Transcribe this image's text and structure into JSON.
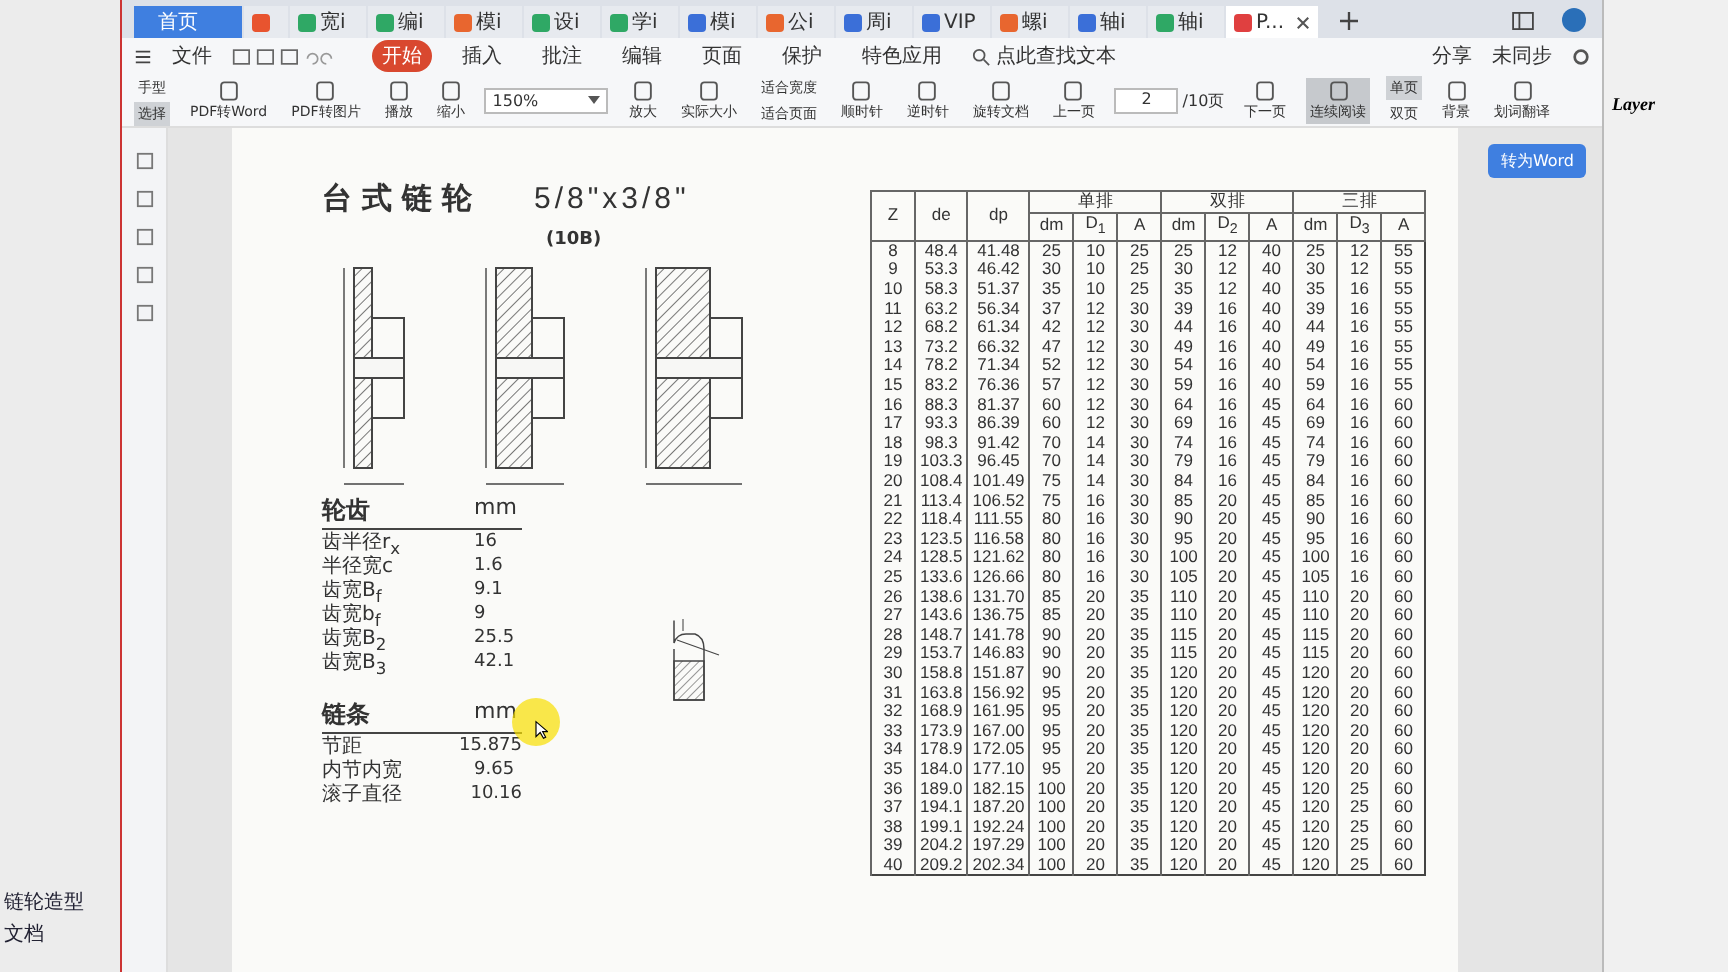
{
  "tabs": [
    {
      "label": "首页",
      "kind": "home",
      "selected": false
    },
    {
      "kind": "app",
      "color": "#e8542f",
      "selected": false
    },
    {
      "label": "宽i",
      "kind": "doc",
      "color": "#2fa865",
      "selected": false
    },
    {
      "label": "编i",
      "kind": "doc",
      "color": "#2fa865",
      "selected": false
    },
    {
      "label": "模i",
      "kind": "doc",
      "color": "#e8662f",
      "selected": false
    },
    {
      "label": "设i",
      "kind": "doc",
      "color": "#2fa865",
      "selected": false
    },
    {
      "label": "学i",
      "kind": "doc",
      "color": "#2fa865",
      "selected": false
    },
    {
      "label": "模i",
      "kind": "doc",
      "color": "#3b6fd8",
      "selected": false
    },
    {
      "label": "公i",
      "kind": "doc",
      "color": "#e8662f",
      "selected": false
    },
    {
      "label": "周i",
      "kind": "doc",
      "color": "#3b6fd8",
      "selected": false
    },
    {
      "label": "VIP",
      "kind": "doc",
      "color": "#3b6fd8",
      "selected": false
    },
    {
      "label": "螺i",
      "kind": "doc",
      "color": "#e8662f",
      "selected": false
    },
    {
      "label": "轴i",
      "kind": "doc",
      "color": "#3b6fd8",
      "selected": false
    },
    {
      "label": "轴i",
      "kind": "doc",
      "color": "#2fa865",
      "selected": false
    },
    {
      "label": "P...",
      "kind": "doc",
      "color": "#e04040",
      "selected": true
    }
  ],
  "menu": {
    "file": "文件",
    "items": [
      {
        "label": "开始",
        "selected": true
      },
      {
        "label": "插入",
        "selected": false
      },
      {
        "label": "批注",
        "selected": false
      },
      {
        "label": "编辑",
        "selected": false
      },
      {
        "label": "页面",
        "selected": false
      },
      {
        "label": "保护",
        "selected": false
      },
      {
        "label": "特色应用",
        "selected": false
      }
    ],
    "search": "点此查找文本",
    "share": "分享",
    "sync": "未同步"
  },
  "toolbar": [
    {
      "kind": "stack",
      "items": [
        {
          "label": "手型",
          "selected": false
        },
        {
          "label": "选择",
          "selected": true
        }
      ]
    },
    {
      "kind": "big",
      "label": "PDF转Word",
      "selected": false
    },
    {
      "kind": "big",
      "label": "PDF转图片",
      "selected": false
    },
    {
      "kind": "big",
      "label": "播放",
      "selected": false
    },
    {
      "kind": "big",
      "label": "缩小",
      "selected": false
    },
    {
      "kind": "zoom",
      "value": "150%"
    },
    {
      "kind": "big",
      "label": "放大",
      "selected": false
    },
    {
      "kind": "big",
      "label": "实际大小",
      "selected": false
    },
    {
      "kind": "stack",
      "items": [
        {
          "label": "适合宽度",
          "selected": false
        },
        {
          "label": "适合页面",
          "selected": false
        }
      ]
    },
    {
      "kind": "big",
      "label": "顺时针",
      "selected": false
    },
    {
      "kind": "big",
      "label": "逆时针",
      "selected": false
    },
    {
      "kind": "big",
      "label": "旋转文档",
      "selected": false
    },
    {
      "kind": "big",
      "label": "上一页",
      "selected": false
    },
    {
      "kind": "page",
      "value": "2",
      "total": "/10页"
    },
    {
      "kind": "big",
      "label": "下一页",
      "selected": false
    },
    {
      "kind": "big",
      "label": "连续阅读",
      "selected": true
    },
    {
      "kind": "stack",
      "items": [
        {
          "label": "单页",
          "selected": true
        },
        {
          "label": "双页",
          "selected": false
        }
      ]
    },
    {
      "kind": "big",
      "label": "背景",
      "selected": false
    },
    {
      "kind": "big",
      "label": "划词翻译",
      "selected": false
    }
  ],
  "to_word": "转为Word",
  "background_app": {
    "layer": "Layer",
    "file": "链轮造型",
    "doc": "文档"
  },
  "doc": {
    "title": "台式链轮",
    "size": "5/8\"x3/8\"",
    "code": "(10B)",
    "tooth": {
      "heading": "轮齿",
      "unit": "mm",
      "rows": [
        [
          "齿半径r$_{x}$",
          "16"
        ],
        [
          "半径宽c",
          "1.6"
        ],
        [
          "齿宽B$_{f}$",
          "9.1"
        ],
        [
          "齿宽b$_{f}$",
          "9"
        ],
        [
          "齿宽B$_{2}$",
          "25.5"
        ],
        [
          "齿宽B$_{3}$",
          "42.1"
        ]
      ]
    },
    "chain": {
      "heading": "链条",
      "unit": "mm",
      "rows": [
        [
          "节距",
          "15.875"
        ],
        [
          "内节内宽",
          "9.65"
        ],
        [
          "滚子直径",
          "10.16"
        ]
      ]
    },
    "table": {
      "top": [
        {
          "label": "Z",
          "kind": "single"
        },
        {
          "label": "de",
          "kind": "single"
        },
        {
          "label": "dp",
          "kind": "single"
        },
        {
          "label": "单排",
          "kind": "group"
        },
        {
          "label": "双排",
          "kind": "group"
        },
        {
          "label": "三排",
          "kind": "group"
        }
      ],
      "sub": [
        "dm",
        "D$_{1}$",
        "A",
        "dm",
        "D$_{2}$",
        "A",
        "dm",
        "D$_{3}$",
        "A"
      ],
      "rows": [
        [
          "8",
          "48.4",
          "41.48",
          "25",
          "10",
          "25",
          "25",
          "12",
          "40",
          "25",
          "12",
          "55"
        ],
        [
          "9",
          "53.3",
          "46.42",
          "30",
          "10",
          "25",
          "30",
          "12",
          "40",
          "30",
          "12",
          "55"
        ],
        [
          "10",
          "58.3",
          "51.37",
          "35",
          "10",
          "25",
          "35",
          "12",
          "40",
          "35",
          "16",
          "55"
        ],
        [
          "11",
          "63.2",
          "56.34",
          "37",
          "12",
          "30",
          "39",
          "16",
          "40",
          "39",
          "16",
          "55"
        ],
        [
          "12",
          "68.2",
          "61.34",
          "42",
          "12",
          "30",
          "44",
          "16",
          "40",
          "44",
          "16",
          "55"
        ],
        [
          "13",
          "73.2",
          "66.32",
          "47",
          "12",
          "30",
          "49",
          "16",
          "40",
          "49",
          "16",
          "55"
        ],
        [
          "14",
          "78.2",
          "71.34",
          "52",
          "12",
          "30",
          "54",
          "16",
          "40",
          "54",
          "16",
          "55"
        ],
        [
          "15",
          "83.2",
          "76.36",
          "57",
          "12",
          "30",
          "59",
          "16",
          "40",
          "59",
          "16",
          "55"
        ],
        [
          "16",
          "88.3",
          "81.37",
          "60",
          "12",
          "30",
          "64",
          "16",
          "45",
          "64",
          "16",
          "60"
        ],
        [
          "17",
          "93.3",
          "86.39",
          "60",
          "12",
          "30",
          "69",
          "16",
          "45",
          "69",
          "16",
          "60"
        ],
        [
          "18",
          "98.3",
          "91.42",
          "70",
          "14",
          "30",
          "74",
          "16",
          "45",
          "74",
          "16",
          "60"
        ],
        [
          "19",
          "103.3",
          "96.45",
          "70",
          "14",
          "30",
          "79",
          "16",
          "45",
          "79",
          "16",
          "60"
        ],
        [
          "20",
          "108.4",
          "101.49",
          "75",
          "14",
          "30",
          "84",
          "16",
          "45",
          "84",
          "16",
          "60"
        ],
        [
          "21",
          "113.4",
          "106.52",
          "75",
          "16",
          "30",
          "85",
          "20",
          "45",
          "85",
          "16",
          "60"
        ],
        [
          "22",
          "118.4",
          "111.55",
          "80",
          "16",
          "30",
          "90",
          "20",
          "45",
          "90",
          "16",
          "60"
        ],
        [
          "23",
          "123.5",
          "116.58",
          "80",
          "16",
          "30",
          "95",
          "20",
          "45",
          "95",
          "16",
          "60"
        ],
        [
          "24",
          "128.5",
          "121.62",
          "80",
          "16",
          "30",
          "100",
          "20",
          "45",
          "100",
          "16",
          "60"
        ],
        [
          "25",
          "133.6",
          "126.66",
          "80",
          "16",
          "30",
          "105",
          "20",
          "45",
          "105",
          "16",
          "60"
        ],
        [
          "26",
          "138.6",
          "131.70",
          "85",
          "20",
          "35",
          "110",
          "20",
          "45",
          "110",
          "20",
          "60"
        ],
        [
          "27",
          "143.6",
          "136.75",
          "85",
          "20",
          "35",
          "110",
          "20",
          "45",
          "110",
          "20",
          "60"
        ],
        [
          "28",
          "148.7",
          "141.78",
          "90",
          "20",
          "35",
          "115",
          "20",
          "45",
          "115",
          "20",
          "60"
        ],
        [
          "29",
          "153.7",
          "146.83",
          "90",
          "20",
          "35",
          "115",
          "20",
          "45",
          "115",
          "20",
          "60"
        ],
        [
          "30",
          "158.8",
          "151.87",
          "90",
          "20",
          "35",
          "120",
          "20",
          "45",
          "120",
          "20",
          "60"
        ],
        [
          "31",
          "163.8",
          "156.92",
          "95",
          "20",
          "35",
          "120",
          "20",
          "45",
          "120",
          "20",
          "60"
        ],
        [
          "32",
          "168.9",
          "161.95",
          "95",
          "20",
          "35",
          "120",
          "20",
          "45",
          "120",
          "20",
          "60"
        ],
        [
          "33",
          "173.9",
          "167.00",
          "95",
          "20",
          "35",
          "120",
          "20",
          "45",
          "120",
          "20",
          "60"
        ],
        [
          "34",
          "178.9",
          "172.05",
          "95",
          "20",
          "35",
          "120",
          "20",
          "45",
          "120",
          "20",
          "60"
        ],
        [
          "35",
          "184.0",
          "177.10",
          "95",
          "20",
          "35",
          "120",
          "20",
          "45",
          "120",
          "20",
          "60"
        ],
        [
          "36",
          "189.0",
          "182.15",
          "100",
          "20",
          "35",
          "120",
          "20",
          "45",
          "120",
          "25",
          "60"
        ],
        [
          "37",
          "194.1",
          "187.20",
          "100",
          "20",
          "35",
          "120",
          "20",
          "45",
          "120",
          "25",
          "60"
        ],
        [
          "38",
          "199.1",
          "192.24",
          "100",
          "20",
          "35",
          "120",
          "20",
          "45",
          "120",
          "25",
          "60"
        ],
        [
          "39",
          "204.2",
          "197.29",
          "100",
          "20",
          "35",
          "120",
          "20",
          "45",
          "120",
          "25",
          "60"
        ],
        [
          "40",
          "209.2",
          "202.34",
          "100",
          "20",
          "35",
          "120",
          "20",
          "45",
          "120",
          "25",
          "60"
        ]
      ]
    }
  }
}
